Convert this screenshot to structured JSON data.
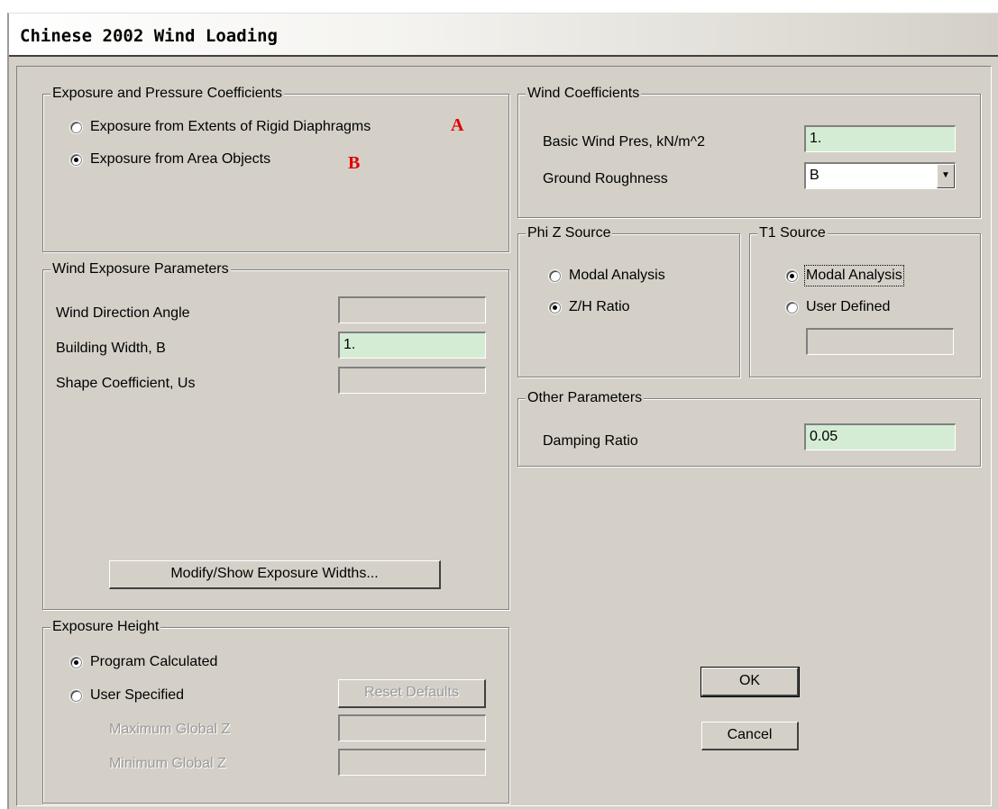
{
  "window": {
    "title": "Chinese 2002 Wind Loading"
  },
  "exposure_coefficients": {
    "legend": "Exposure and Pressure Coefficients",
    "option_diaphragms": "Exposure from Extents of Rigid Diaphragms",
    "option_area_objects": "Exposure from Area Objects",
    "selected": "option_area_objects",
    "annotation_a": "A",
    "annotation_b": "B"
  },
  "wind_exposure": {
    "legend": "Wind Exposure Parameters",
    "direction_label": "Wind Direction Angle",
    "direction_value": "",
    "width_label": "Building Width, B",
    "width_value": "1.",
    "shape_label": "Shape Coefficient, Us",
    "shape_value": "",
    "modify_button": "Modify/Show Exposure Widths..."
  },
  "exposure_height": {
    "legend": "Exposure Height",
    "option_program": "Program Calculated",
    "option_user": "User Specified",
    "selected": "option_program",
    "reset_button": "Reset Defaults",
    "max_label": "Maximum Global Z",
    "max_value": "",
    "min_label": "Minimum Global Z",
    "min_value": ""
  },
  "wind_coefficients": {
    "legend": "Wind Coefficients",
    "pressure_label": "Basic Wind Pres, kN/m^2",
    "pressure_value": "1.",
    "roughness_label": "Ground Roughness",
    "roughness_value": "B"
  },
  "phiz_source": {
    "legend": "Phi Z Source",
    "option_modal": "Modal Analysis",
    "option_zh": "Z/H Ratio",
    "selected": "option_zh"
  },
  "t1_source": {
    "legend": "T1 Source",
    "option_modal": "Modal Analysis",
    "option_user": "User Defined",
    "selected": "option_modal",
    "user_value": ""
  },
  "other_parameters": {
    "legend": "Other Parameters",
    "damping_label": "Damping Ratio",
    "damping_value": "0.05"
  },
  "buttons": {
    "ok": "OK",
    "cancel": "Cancel"
  },
  "colors": {
    "field_green": "#d4ecd4",
    "dialog_bg": "#d4d0c8",
    "annotation": "#e00000"
  }
}
